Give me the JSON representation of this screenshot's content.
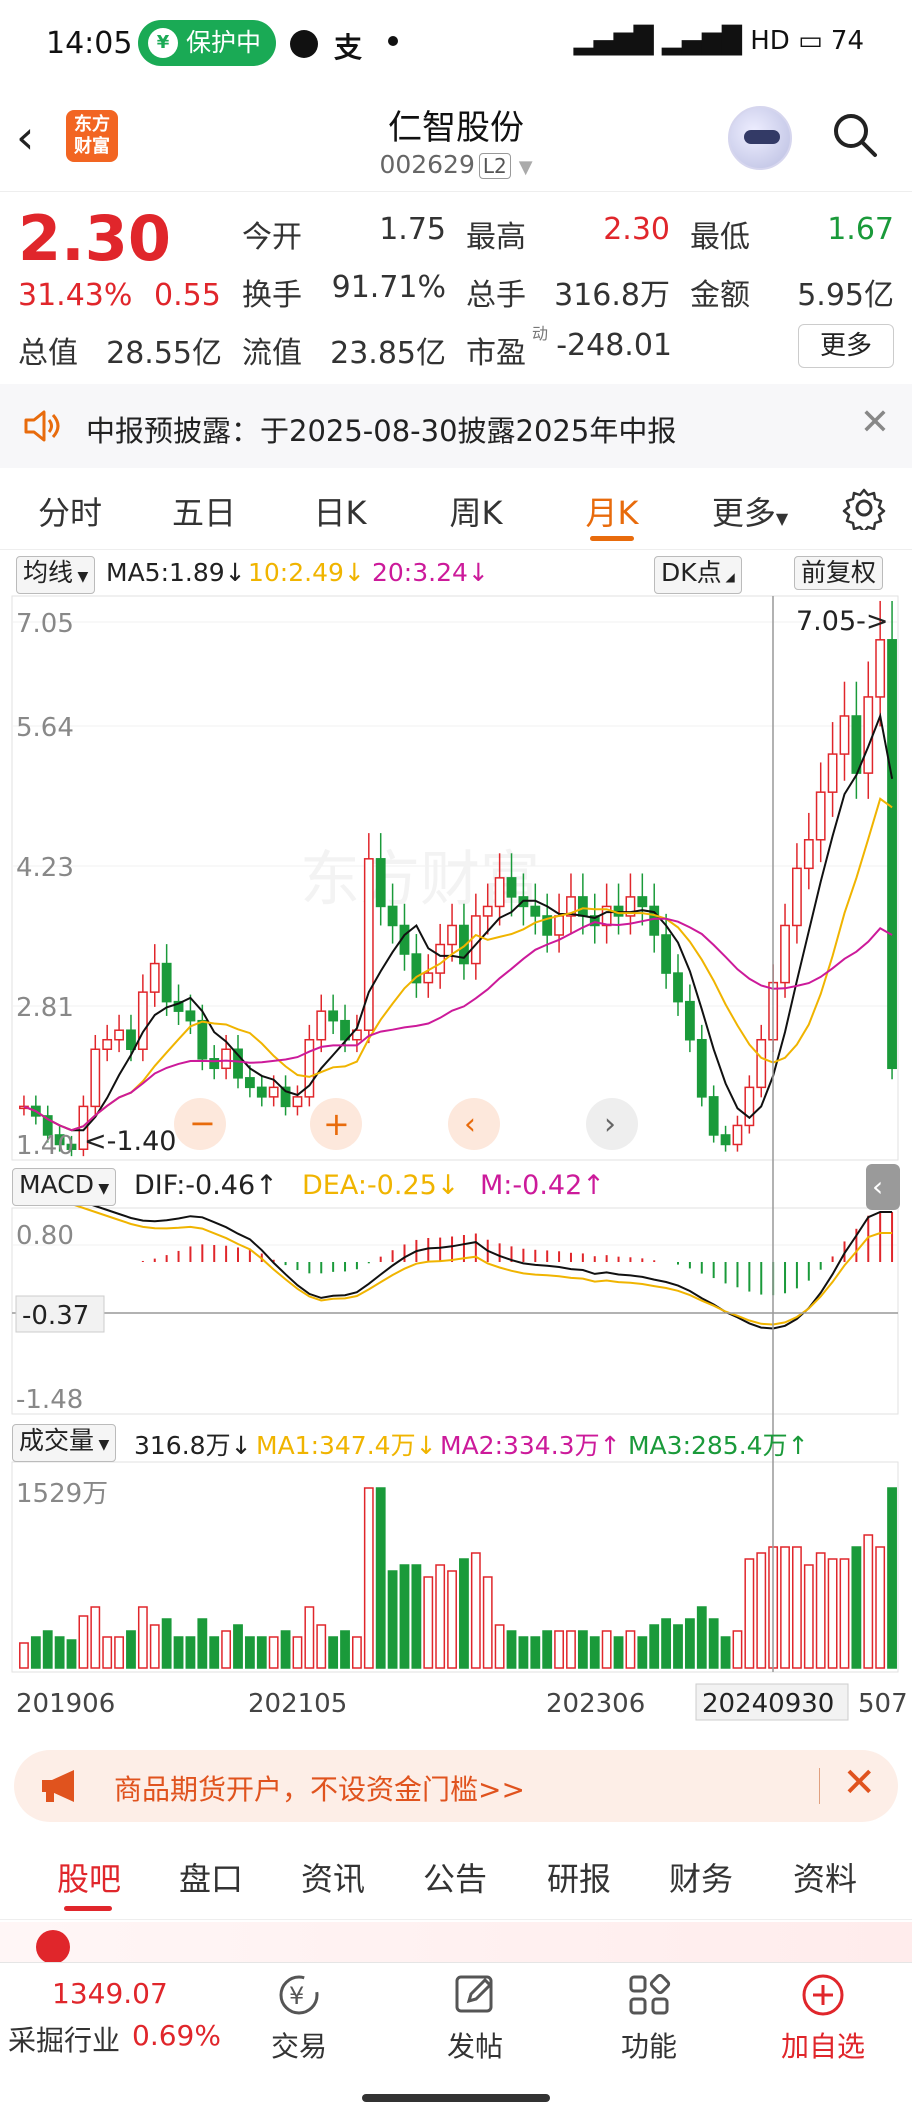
{
  "status_bar": {
    "time": "14:05",
    "protect_label": "保护中",
    "right_icons": "4G 4G HD 74",
    "battery": "74"
  },
  "header": {
    "back_icon": "back-arrow-icon",
    "logo_text": "东方财富",
    "title": "仁智股份",
    "code": "002629",
    "level": "L2"
  },
  "quote": {
    "price": "2.30",
    "change_pct": "31.43%",
    "change": "0.55",
    "fields": [
      {
        "label": "今开",
        "value": "1.75"
      },
      {
        "label": "最高",
        "value": "2.30"
      },
      {
        "label": "最低",
        "value": "1.67"
      },
      {
        "label": "换手",
        "value": "91.71%"
      },
      {
        "label": "总手",
        "value": "316.8万"
      },
      {
        "label": "金额",
        "value": "5.95亿"
      },
      {
        "label": "总值",
        "value": "28.55亿"
      },
      {
        "label": "流值",
        "value": "23.85亿"
      },
      {
        "label": "市盈",
        "value": "-248.01"
      }
    ],
    "pe_super": "动",
    "more": "更多"
  },
  "notice": {
    "text": "中报预披露：于2025-08-30披露2025年中报"
  },
  "tabs": [
    "分时",
    "五日",
    "日K",
    "周K",
    "月K",
    "更多"
  ],
  "active_tab": "月K",
  "chart": {
    "ma_selector": "均线",
    "ma5": "MA5:1.89↓",
    "ma10": "10:2.49↓",
    "ma20": "20:3.24↓",
    "dk_label": "DK点",
    "fq_label": "前复权",
    "price_ticks": [
      "7.05",
      "5.64",
      "4.23",
      "2.81",
      "1.40"
    ],
    "high_mark": "7.05->",
    "low_mark": "<-1.40",
    "macd_selector": "MACD",
    "dif": "DIF:-0.46↑",
    "dea": "DEA:-0.25↓",
    "m": "M:-0.42↑",
    "macd_ticks": [
      "0.80",
      "-0.37",
      "-1.48"
    ],
    "vol_selector": "成交量",
    "vol_now": "316.8万↓",
    "vol_ma1": "MA1:347.4万↓",
    "vol_ma2": "MA2:334.3万↑",
    "vol_ma3": "MA3:285.4万↑",
    "vol_top": "1529万",
    "x_labels": [
      "201906",
      "202105",
      "202306",
      "20240930",
      "507"
    ],
    "colors": {
      "up": "#e0262b",
      "down": "#1a9a3a",
      "ma5": "#111111",
      "ma10": "#f0b400",
      "ma20": "#cc1a9a"
    }
  },
  "chart_data": {
    "type": "candlestick",
    "price_axis": [
      1.4,
      7.05
    ],
    "series_count_months": 74,
    "ma_values": {
      "MA5": 1.89,
      "MA10": 2.49,
      "MA20": 3.24
    }
  },
  "ad": {
    "text": "商品期货开户，不设资金门槛>>"
  },
  "bottom_tabs": [
    "股吧",
    "盘口",
    "资讯",
    "公告",
    "研报",
    "财务",
    "资料"
  ],
  "bottom_nav": {
    "index_value": "1349.07",
    "index_name": "采掘行业",
    "index_pct": "0.69%",
    "items": [
      "交易",
      "发帖",
      "功能",
      "加自选"
    ]
  }
}
